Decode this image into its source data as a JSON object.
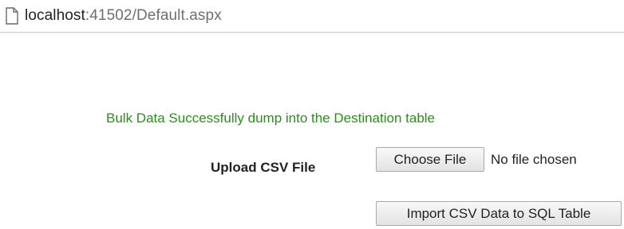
{
  "address_bar": {
    "page_icon": "page-icon",
    "url_host": "localhost",
    "url_rest": ":41502/Default.aspx"
  },
  "main": {
    "status_message": "Bulk Data Successfully dump into the Destination table",
    "status_color": "#2e8b1f",
    "upload_label": "Upload CSV File",
    "choose_file_button": "Choose File",
    "file_status": "No file chosen",
    "import_button": "Import CSV Data to SQL Table"
  }
}
